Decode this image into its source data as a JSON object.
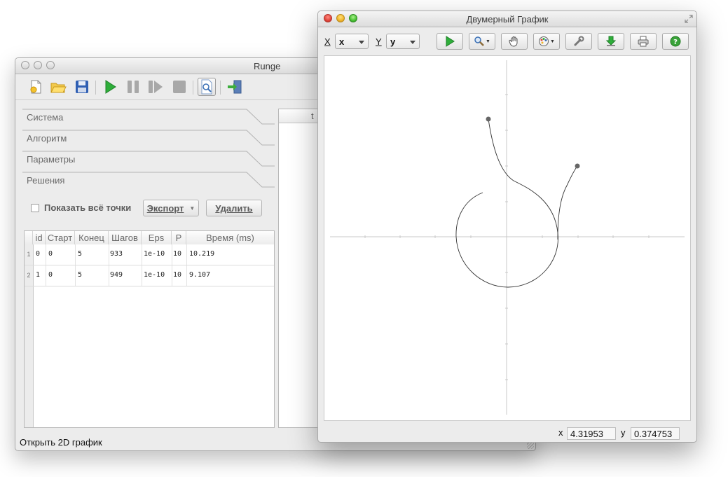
{
  "runge": {
    "title": "Runge",
    "toolbar": [
      "new-file-icon",
      "open-folder-icon",
      "save-disk-icon",
      "run-icon",
      "pause-icon",
      "step-icon",
      "stop-icon",
      "preview-icon",
      "exit-icon"
    ],
    "sections": [
      "Система",
      "Алгоритм",
      "Параметры",
      "Решения"
    ],
    "show_all_points": "Показать всё точки",
    "export_label": "Экспорт",
    "delete_label": "Удалить",
    "table": {
      "columns": [
        "id",
        "Старт",
        "Конец",
        "Шагов",
        "Eps",
        "P",
        "Время (ms)"
      ],
      "rows": [
        {
          "n": "1",
          "cells": [
            "0",
            "0",
            "5",
            "933",
            "1e-10",
            "10",
            "10.219"
          ]
        },
        {
          "n": "2",
          "cells": [
            "1",
            "0",
            "5",
            "949",
            "1e-10",
            "10",
            "9.107"
          ]
        }
      ]
    },
    "right_header": "t",
    "status": "Открыть 2D график"
  },
  "plot": {
    "title": "Двумерный График",
    "x_label": "X",
    "x_value": "x",
    "y_label": "Y",
    "y_value": "y",
    "toolbar_icons": [
      "run-icon",
      "zoom-icon",
      "hand-pan-icon",
      "palette-icon",
      "wrench-icon",
      "download-icon",
      "printer-icon",
      "help-icon"
    ],
    "coord_x_label": "x",
    "coord_x": "4.31953",
    "coord_y_label": "y",
    "coord_y": "0.374753"
  }
}
